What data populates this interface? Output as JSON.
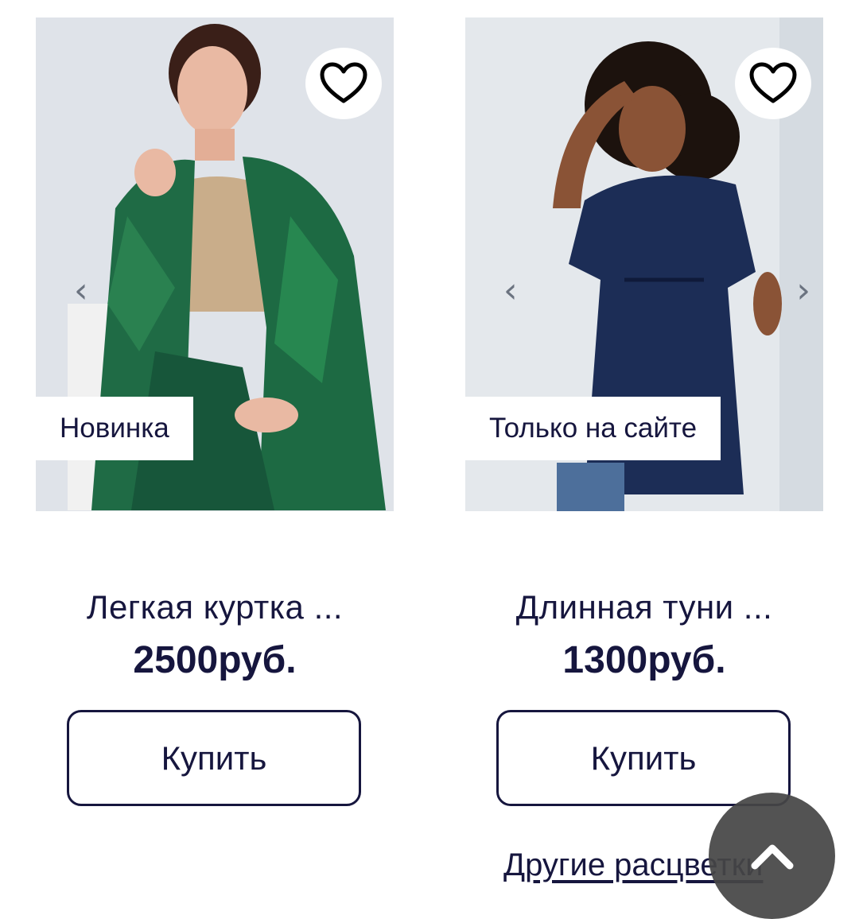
{
  "products": [
    {
      "badge": "Новинка",
      "title": "Легкая куртка ...",
      "price": "2500руб.",
      "buy_label": "Купить",
      "prev_arrow": "‹",
      "favorite_icon": "heart-outline-icon"
    },
    {
      "badge": "Только на сайте",
      "title": "Длинная туни ...",
      "price": "1300руб.",
      "buy_label": "Купить",
      "prev_arrow": "‹",
      "next_arrow": "›",
      "favorite_icon": "heart-outline-icon",
      "other_colors_label": "Другие расцветки"
    }
  ],
  "scroll_top_icon": "chevron-up-icon",
  "colors": {
    "text": "#16163e",
    "photo_bg": "#dde2e8",
    "scroll_button": "#464646"
  }
}
